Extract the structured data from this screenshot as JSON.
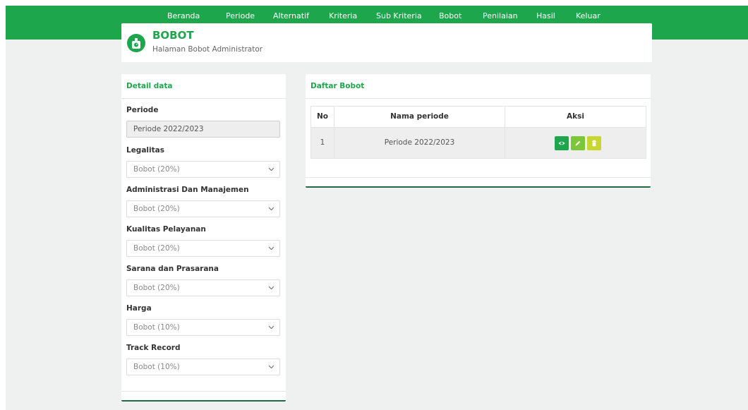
{
  "nav": {
    "items": [
      {
        "label": "Beranda"
      },
      {
        "label": "Periode"
      },
      {
        "label": "Alternatif"
      },
      {
        "label": "Kriteria"
      },
      {
        "label": "Sub Kriteria"
      },
      {
        "label": "Bobot"
      },
      {
        "label": "Penilaian"
      },
      {
        "label": "Hasil"
      },
      {
        "label": "Keluar"
      }
    ]
  },
  "header": {
    "icon": "scale-icon",
    "title": "BOBOT",
    "subtitle": "Halaman Bobot Administrator"
  },
  "detail": {
    "title": "Detail data",
    "periode_label": "Periode",
    "periode_value": "Periode 2022/2023",
    "fields": [
      {
        "label": "Legalitas",
        "value": "Bobot (20%)"
      },
      {
        "label": "Administrasi Dan Manajemen",
        "value": "Bobot (20%)"
      },
      {
        "label": "Kualitas Pelayanan",
        "value": "Bobot (20%)"
      },
      {
        "label": "Sarana dan Prasarana",
        "value": "Bobot (20%)"
      },
      {
        "label": "Harga",
        "value": "Bobot (10%)"
      },
      {
        "label": "Track Record",
        "value": "Bobot (10%)"
      }
    ]
  },
  "list": {
    "title": "Daftar Bobot",
    "columns": [
      "No",
      "Nama periode",
      "Aksi"
    ],
    "rows": [
      {
        "no": "1",
        "nama": "Periode 2022/2023"
      }
    ],
    "actions": {
      "view_icon": "eye-icon",
      "edit_icon": "pencil-icon",
      "delete_icon": "trash-icon"
    }
  },
  "colors": {
    "brand": "#1ea64c",
    "view_button": "#1ea64c",
    "edit_button": "#7cc63a",
    "delete_button": "#c7d730",
    "footer_line": "#1f6b3f"
  }
}
